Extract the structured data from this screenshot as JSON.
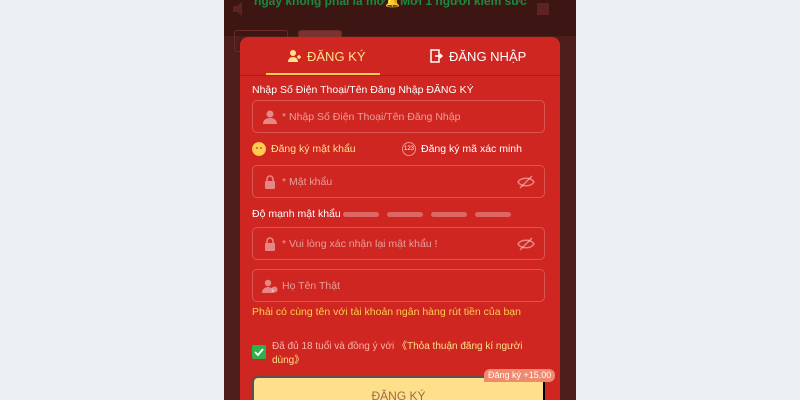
{
  "background": {
    "marquee": "ngày không phải là mơ🔔Mời 1 người kiếm sức"
  },
  "tabs": [
    {
      "label": "ĐĂNG KÝ",
      "icon": "user-add-icon",
      "active": true
    },
    {
      "label": "ĐĂNG NHẬP",
      "icon": "login-door-icon",
      "active": false
    }
  ],
  "form": {
    "account_label": "Nhập Số Điện Thoại/Tên Đăng Nhập ĐĂNG KÝ",
    "account_placeholder": "* Nhập Số Điện Thoại/Tên Đăng Nhập",
    "mode_password": "Đăng ký mật khẩu",
    "mode_code": "Đăng ký mã xác minh",
    "mode_code_badge": "123",
    "password_placeholder": "* Mật khẩu",
    "strength_label": "Độ mạnh mật khẩu",
    "confirm_placeholder": "* Vui lòng xác nhận lại mật khẩu !",
    "realname_placeholder": "Họ Tên Thật",
    "realname_hint": "Phải có cùng tên với tài khoản ngân hàng rút tiền của bạn",
    "agree_text": "Đã đủ 18 tuổi và đồng ý với",
    "agree_link": "《Thỏa thuận đăng kí người dùng》",
    "agree_checked": true,
    "submit_label": "ĐĂNG KÝ",
    "bonus_badge": "Đăng ký +15.00"
  },
  "colors": {
    "panel": "#cf2621",
    "accent": "#ffe08a",
    "checkbox": "#2bb24c"
  }
}
